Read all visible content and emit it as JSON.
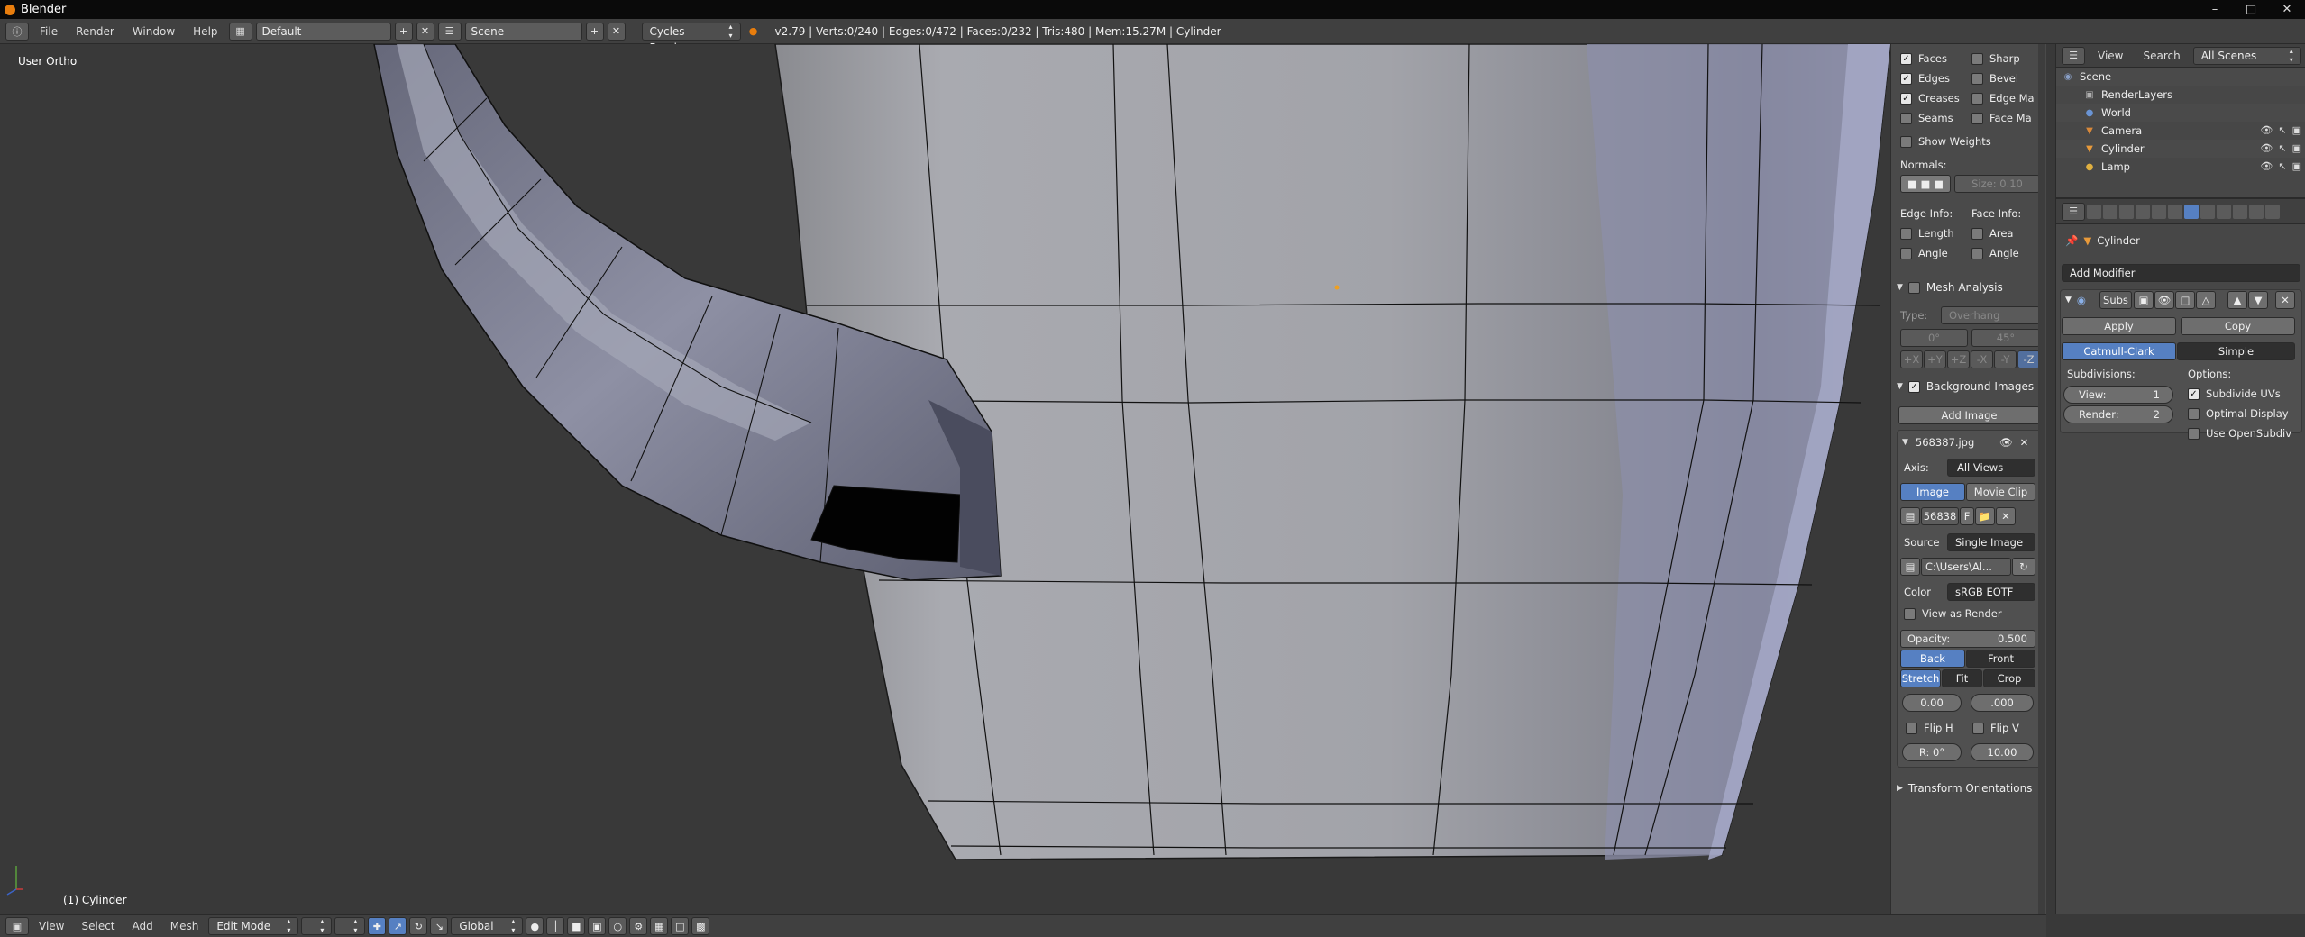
{
  "window": {
    "title": "Blender",
    "minimize": "–",
    "maximize": "□",
    "close": "✕"
  },
  "topbar": {
    "menu": [
      "File",
      "Render",
      "Window",
      "Help"
    ],
    "screen_layout": "Default",
    "scene": "Scene",
    "render_engine": "Cycles Render",
    "stats": "v2.79 | Verts:0/240 | Edges:0/472 | Faces:0/232 | Tris:480 | Mem:15.27M | Cylinder"
  },
  "viewport": {
    "view_label": "User Ortho",
    "object_label": "(1) Cylinder"
  },
  "bottombar": {
    "menu": [
      "View",
      "Select",
      "Add",
      "Mesh"
    ],
    "mode": "Edit Mode",
    "orientation": "Global"
  },
  "npanel": {
    "overlay": {
      "faces": "Faces",
      "sharp": "Sharp",
      "edges": "Edges",
      "bevel": "Bevel",
      "creases": "Creases",
      "edge_marks": "Edge Ma",
      "seams": "Seams",
      "face_marks": "Face Ma",
      "show_weights": "Show Weights",
      "normals": "Normals:",
      "normal_size": "Size: 0.10",
      "edge_info": "Edge Info:",
      "face_info": "Face Info:",
      "length": "Length",
      "area": "Area",
      "angle_e": "Angle",
      "angle_f": "Angle"
    },
    "mesh_analysis": {
      "title": "Mesh Analysis",
      "type_label": "Type:",
      "type_value": "Overhang",
      "min": "0°",
      "max": "45°",
      "axes": [
        "+X",
        "+Y",
        "+Z",
        "-X",
        "-Y",
        "-Z"
      ]
    },
    "background_images": {
      "title": "Background Images",
      "add_image": "Add Image",
      "image_name": "568387.jpg",
      "axis_label": "Axis:",
      "axis_value": "All Views",
      "image_tab": "Image",
      "movieclip_tab": "Movie Clip",
      "image_field": "56838",
      "image_flag": "F",
      "source_label": "Source",
      "source_value": "Single Image",
      "path": "C:\\Users\\Al...",
      "color_label": "Color",
      "color_value": "sRGB EOTF",
      "view_as_render": "View as Render",
      "opacity_label": "Opacity:",
      "opacity_value": "0.500",
      "back": "Back",
      "front": "Front",
      "stretch": "Stretch",
      "fit": "Fit",
      "crop": "Crop",
      "x_offset": "0.00",
      "y_offset": ".000",
      "flip_h": "Flip H",
      "flip_v": "Flip V",
      "rotation": "R: 0°",
      "size": "10.00"
    },
    "transform_orientations": "Transform Orientations"
  },
  "outliner": {
    "menu": [
      "View",
      "Search"
    ],
    "filter": "All Scenes",
    "items": [
      {
        "label": "Scene",
        "icon_color": "#8aa0c8"
      },
      {
        "label": "RenderLayers",
        "icon_color": "#b0b0b0"
      },
      {
        "label": "World",
        "icon_color": "#6a94d4"
      },
      {
        "label": "Camera",
        "icon_color": "#d8883a"
      },
      {
        "label": "Cylinder",
        "icon_color": "#e89a3a"
      },
      {
        "label": "Lamp",
        "icon_color": "#e0b040"
      }
    ]
  },
  "properties": {
    "object_name": "Cylinder",
    "add_modifier": "Add Modifier",
    "modifier_name": "Subs",
    "apply": "Apply",
    "copy": "Copy",
    "catmull": "Catmull-Clark",
    "simple": "Simple",
    "subdivisions_label": "Subdivisions:",
    "options_label": "Options:",
    "view_label": "View:",
    "view_value": "1",
    "render_label": "Render:",
    "render_value": "2",
    "subdivide_uvs": "Subdivide UVs",
    "optimal_display": "Optimal Display",
    "use_opensubdiv": "Use OpenSubdiv"
  },
  "colors": {
    "accent": "#5680c2",
    "viewport_bg": "#393939",
    "mesh_face": "#a4a6ad",
    "selection_dot": "#f0a020"
  }
}
